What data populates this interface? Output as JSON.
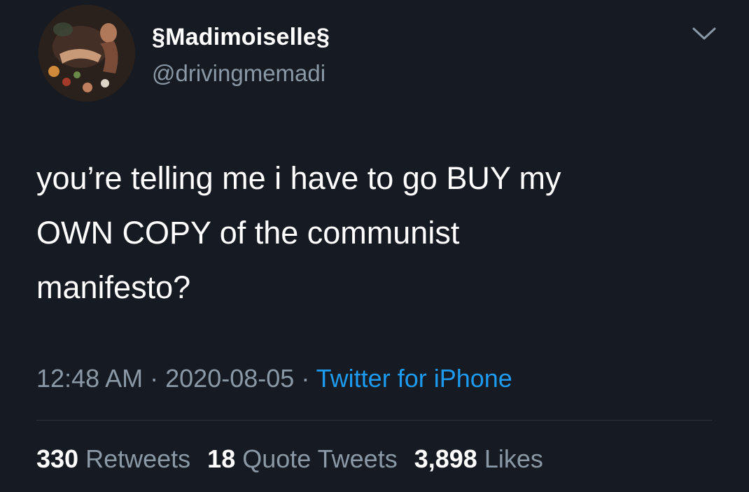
{
  "user": {
    "display_name": "§Madimoiselle§",
    "handle": "@drivingmemadi",
    "avatar_icon": "profile-photo"
  },
  "tweet": {
    "text": "you’re telling me i have to go BUY my\nOWN COPY of the communist\nmanifesto?",
    "time": "12:48 AM",
    "separator": "·",
    "date": "2020-08-05",
    "source": "Twitter for iPhone"
  },
  "stats": {
    "retweets_count": "330",
    "retweets_label": "Retweets",
    "quotes_count": "18",
    "quotes_label": "Quote Tweets",
    "likes_count": "3,898",
    "likes_label": "Likes"
  },
  "colors": {
    "background": "#161a22",
    "text": "#ffffff",
    "secondary": "#8b98a5",
    "link": "#1d9bf0"
  }
}
